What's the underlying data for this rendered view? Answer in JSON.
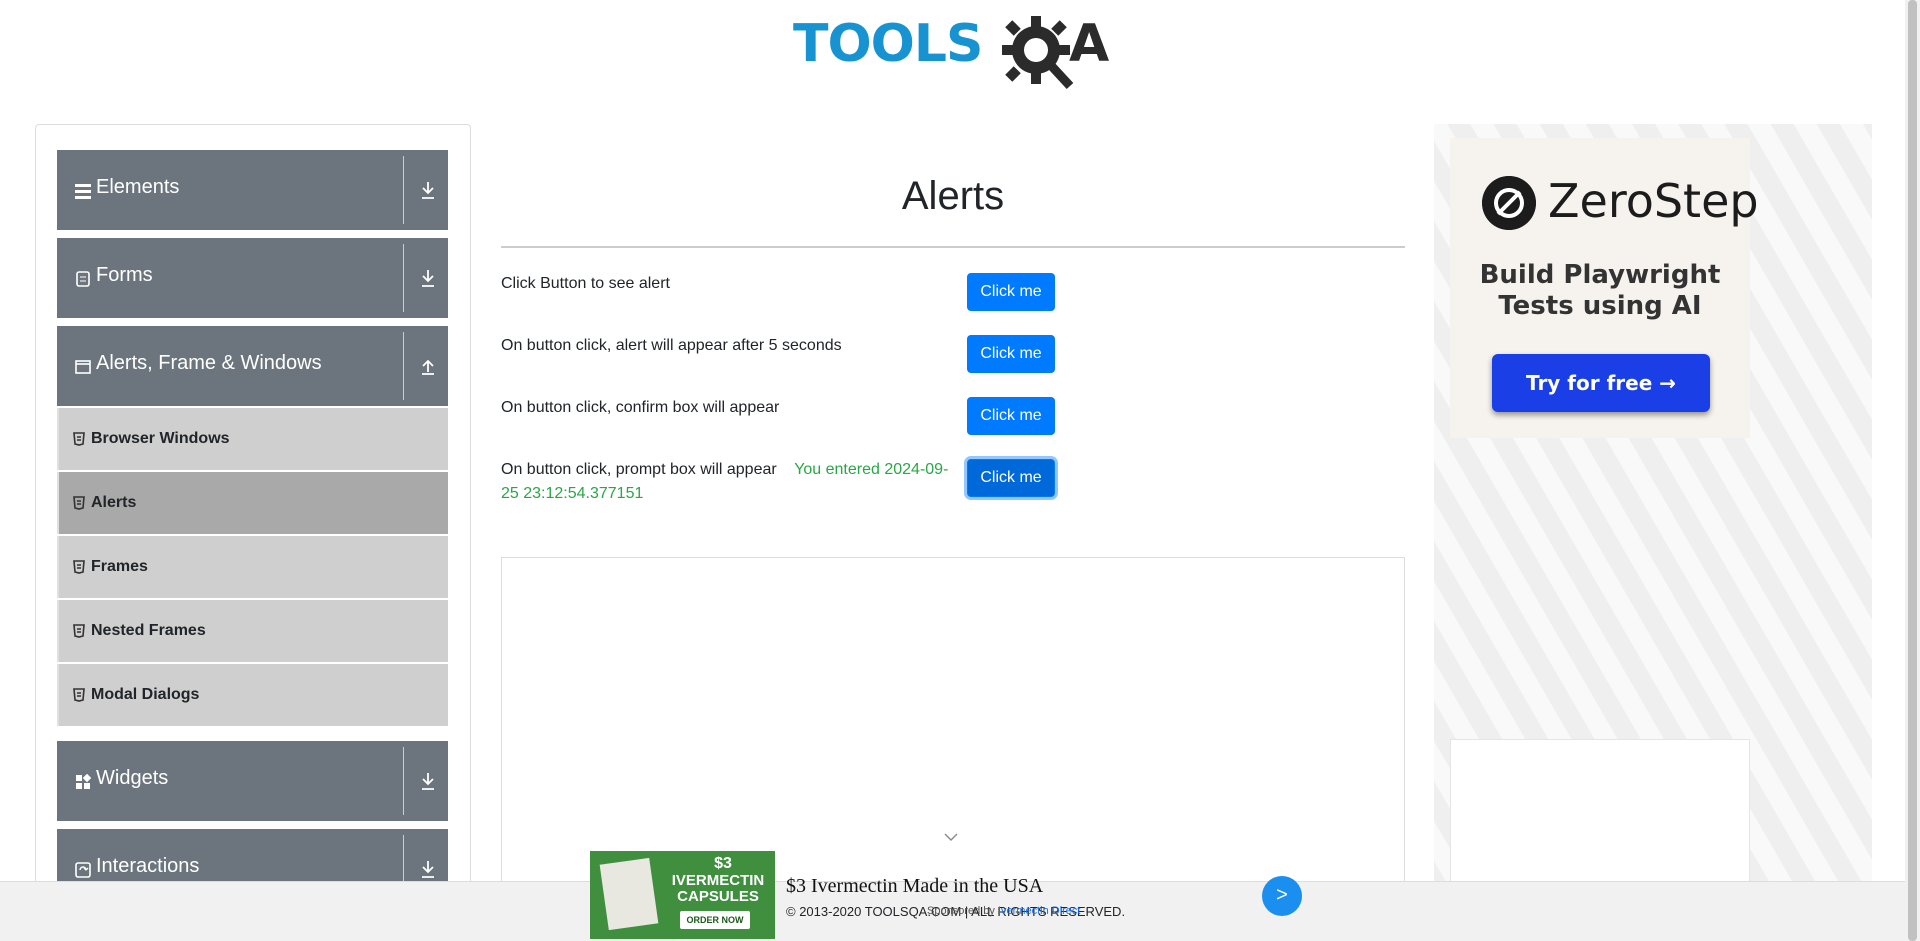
{
  "logo": {
    "text_main": "TOOLS",
    "text_q": "Q",
    "text_a": "A"
  },
  "sidebar": {
    "groups": [
      {
        "label": "Elements",
        "icon": "menu-icon",
        "expanded": false
      },
      {
        "label": "Forms",
        "icon": "form-icon",
        "expanded": false
      },
      {
        "label": "Alerts, Frame & Windows",
        "icon": "window-icon",
        "expanded": true
      },
      {
        "label": "Widgets",
        "icon": "widgets-icon",
        "expanded": false
      },
      {
        "label": "Interactions",
        "icon": "interactions-icon",
        "expanded": false
      }
    ],
    "items": [
      {
        "label": "Browser Windows"
      },
      {
        "label": "Alerts"
      },
      {
        "label": "Frames"
      },
      {
        "label": "Nested Frames"
      },
      {
        "label": "Modal Dialogs"
      }
    ],
    "active_item": "Alerts"
  },
  "main": {
    "title": "Alerts",
    "rows": [
      {
        "text": "Click Button to see alert",
        "button": "Click me"
      },
      {
        "text": "On button click, alert will appear after 5 seconds",
        "button": "Click me"
      },
      {
        "text": "On button click, confirm box will appear",
        "button": "Click me"
      },
      {
        "text": "On button click, prompt box will appear",
        "result": "You entered 2024-09-25 23:12:54.377151",
        "button": "Click me"
      }
    ]
  },
  "right_ad": {
    "brand": "ZeroStep",
    "tagline": "Build Playwright Tests using AI",
    "cta": "Try for free →"
  },
  "bottom_ad": {
    "img_price": "$3",
    "img_title": "IVERMECTIN CAPSULES",
    "img_cta": "ORDER NOW",
    "headline": "$3 Ivermectin Made in the USA",
    "sponsor_prefix": "Sponsored by",
    "sponsor_name": "Ivermectin Direct",
    "go": ">"
  },
  "footer": {
    "copyright": "© 2013-2020 TOOLSQA.COM | ALL RIGHTS RESERVED."
  },
  "colors": {
    "primary": "#007bff",
    "sidebar_group": "#6c757d",
    "success": "#28a745",
    "logo_blue": "#1893d1"
  }
}
